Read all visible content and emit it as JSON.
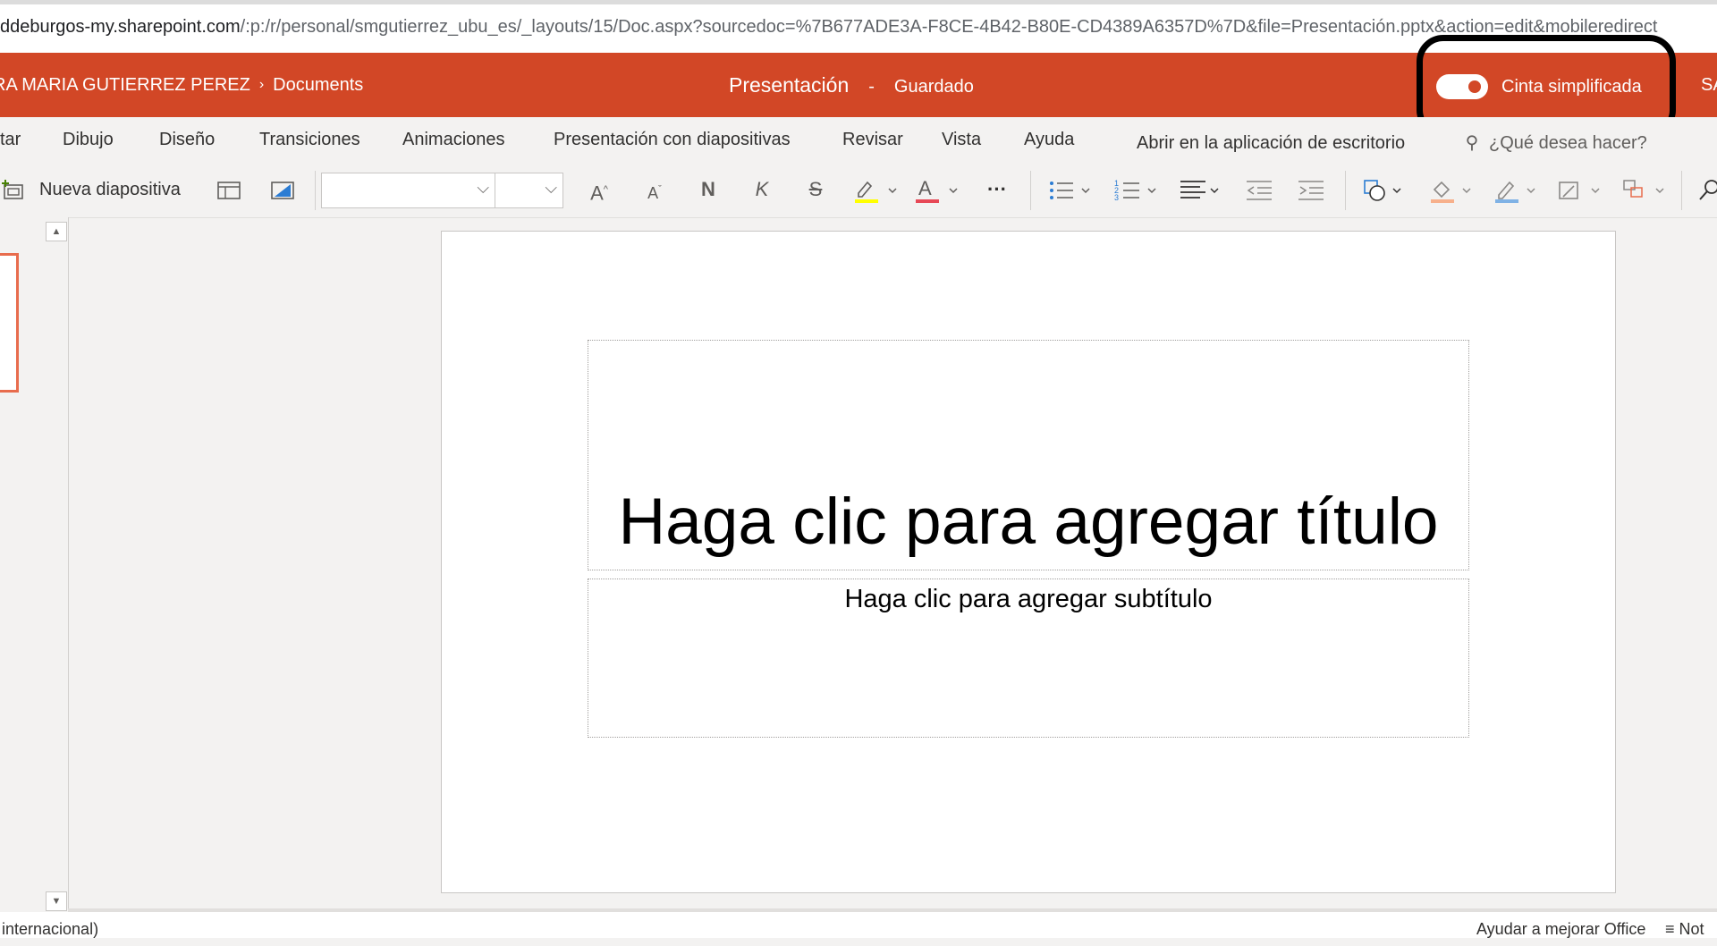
{
  "browser": {
    "url_host": "ddeburgos-my.sharepoint.com",
    "url_path": "/:p:/r/personal/smgutierrez_ubu_es/_layouts/15/Doc.aspx?sourcedoc=%7B677ADE3A-F8CE-4B42-B80E-CD4389A6357D%7D&file=Presentación.pptx&action=edit&mobileredirect"
  },
  "titlebar": {
    "user": "RA MARIA GUTIERREZ PEREZ",
    "separator": "›",
    "folder": "Documents",
    "doc_name": "Presentación",
    "dash": "-",
    "save_state": "Guardado",
    "toggle_label": "Cinta simplificada",
    "toggle_on": true,
    "initials": "SA",
    "accent_color": "#d24726"
  },
  "tabs": [
    {
      "label": "tar"
    },
    {
      "label": "Dibujo"
    },
    {
      "label": "Diseño"
    },
    {
      "label": "Transiciones"
    },
    {
      "label": "Animaciones"
    },
    {
      "label": "Presentación con diapositivas"
    },
    {
      "label": "Revisar"
    },
    {
      "label": "Vista"
    },
    {
      "label": "Ayuda"
    }
  ],
  "open_desktop": "Abrir en la aplicación de escritorio",
  "tell_me": "¿Qué desea hacer?",
  "ribbon": {
    "new_slide": "Nueva diapositiva",
    "font_name": "",
    "font_size": "",
    "bold": "N",
    "italic": "K",
    "strike": "S",
    "more": "···"
  },
  "slide": {
    "title_placeholder": "Haga clic para agregar título",
    "subtitle_placeholder": "Haga clic para agregar subtítulo"
  },
  "status": {
    "language": "internacional)",
    "help": "Ayudar a mejorar Office",
    "notes": "Not"
  }
}
